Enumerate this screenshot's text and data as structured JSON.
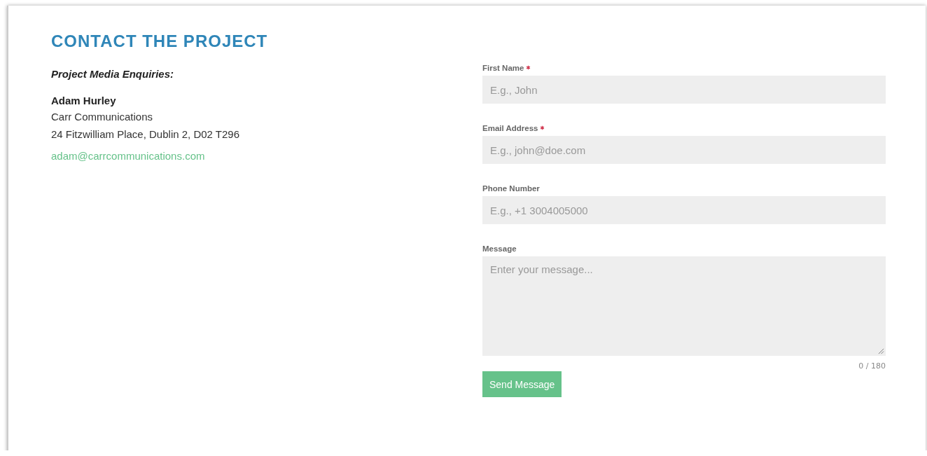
{
  "title": "CONTACT THE PROJECT",
  "contact": {
    "heading": "Project Media Enquiries:",
    "name": "Adam Hurley",
    "company": "Carr Communications",
    "address": "24 Fitzwilliam Place, Dublin 2, D02 T296",
    "email": "adam@carrcommunications.com"
  },
  "form": {
    "fields": [
      {
        "kind": "input",
        "label": "First Name",
        "required": true,
        "placeholder": "E.g., John"
      },
      {
        "kind": "input",
        "label": "Email Address",
        "required": true,
        "placeholder": "E.g., john@doe.com"
      },
      {
        "kind": "input",
        "label": "Phone Number",
        "required": false,
        "placeholder": "E.g., +1 3004005000"
      },
      {
        "kind": "textarea",
        "label": "Message",
        "required": false,
        "placeholder": "Enter your message...",
        "counter": "0 / 180"
      }
    ],
    "submit": "Send Message"
  }
}
